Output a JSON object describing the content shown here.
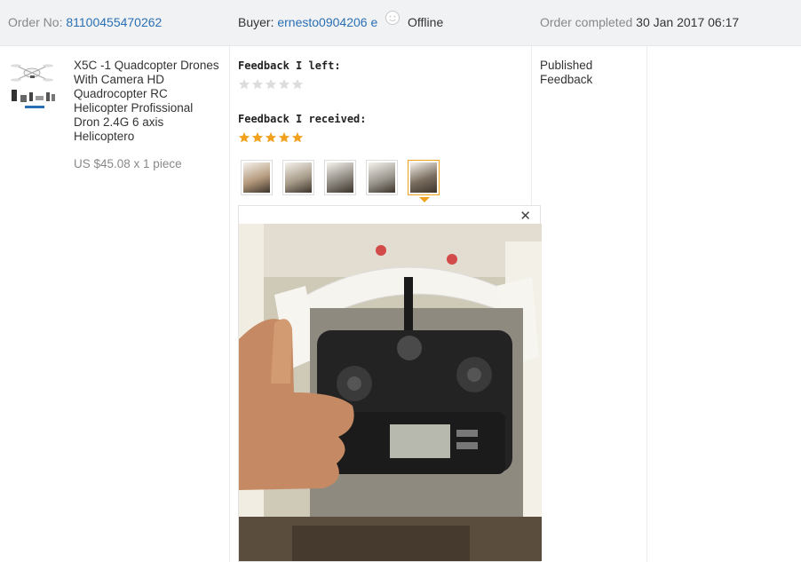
{
  "header": {
    "order_label": "Order No:",
    "order_number": "81100455470262",
    "buyer_label": "Buyer:",
    "buyer_name": "ernesto0904206 e",
    "buyer_status": "Offline",
    "order_status_label": "Order completed",
    "order_datetime": "30 Jan 2017 06:17"
  },
  "product": {
    "title": "X5C -1 Quadcopter Drones With Camera HD Quadrocopter RC Helicopter Profissional Dron 2.4G 6 axis Helicoptero",
    "price": "US $45.08 x 1 piece"
  },
  "feedback": {
    "left_label": "Feedback I left:",
    "left_rating": 0,
    "received_label": "Feedback I received:",
    "received_rating": 5,
    "photo_count": 5,
    "selected_photo": 5
  },
  "status": {
    "text": "Published Feedback"
  },
  "colors": {
    "link": "#2a6fb4",
    "star_filled": "#f0a11e",
    "star_empty": "#dddddd",
    "header_bg": "#f1f2f4"
  },
  "icons": [
    "smiley-icon",
    "star-icon",
    "close-icon"
  ]
}
